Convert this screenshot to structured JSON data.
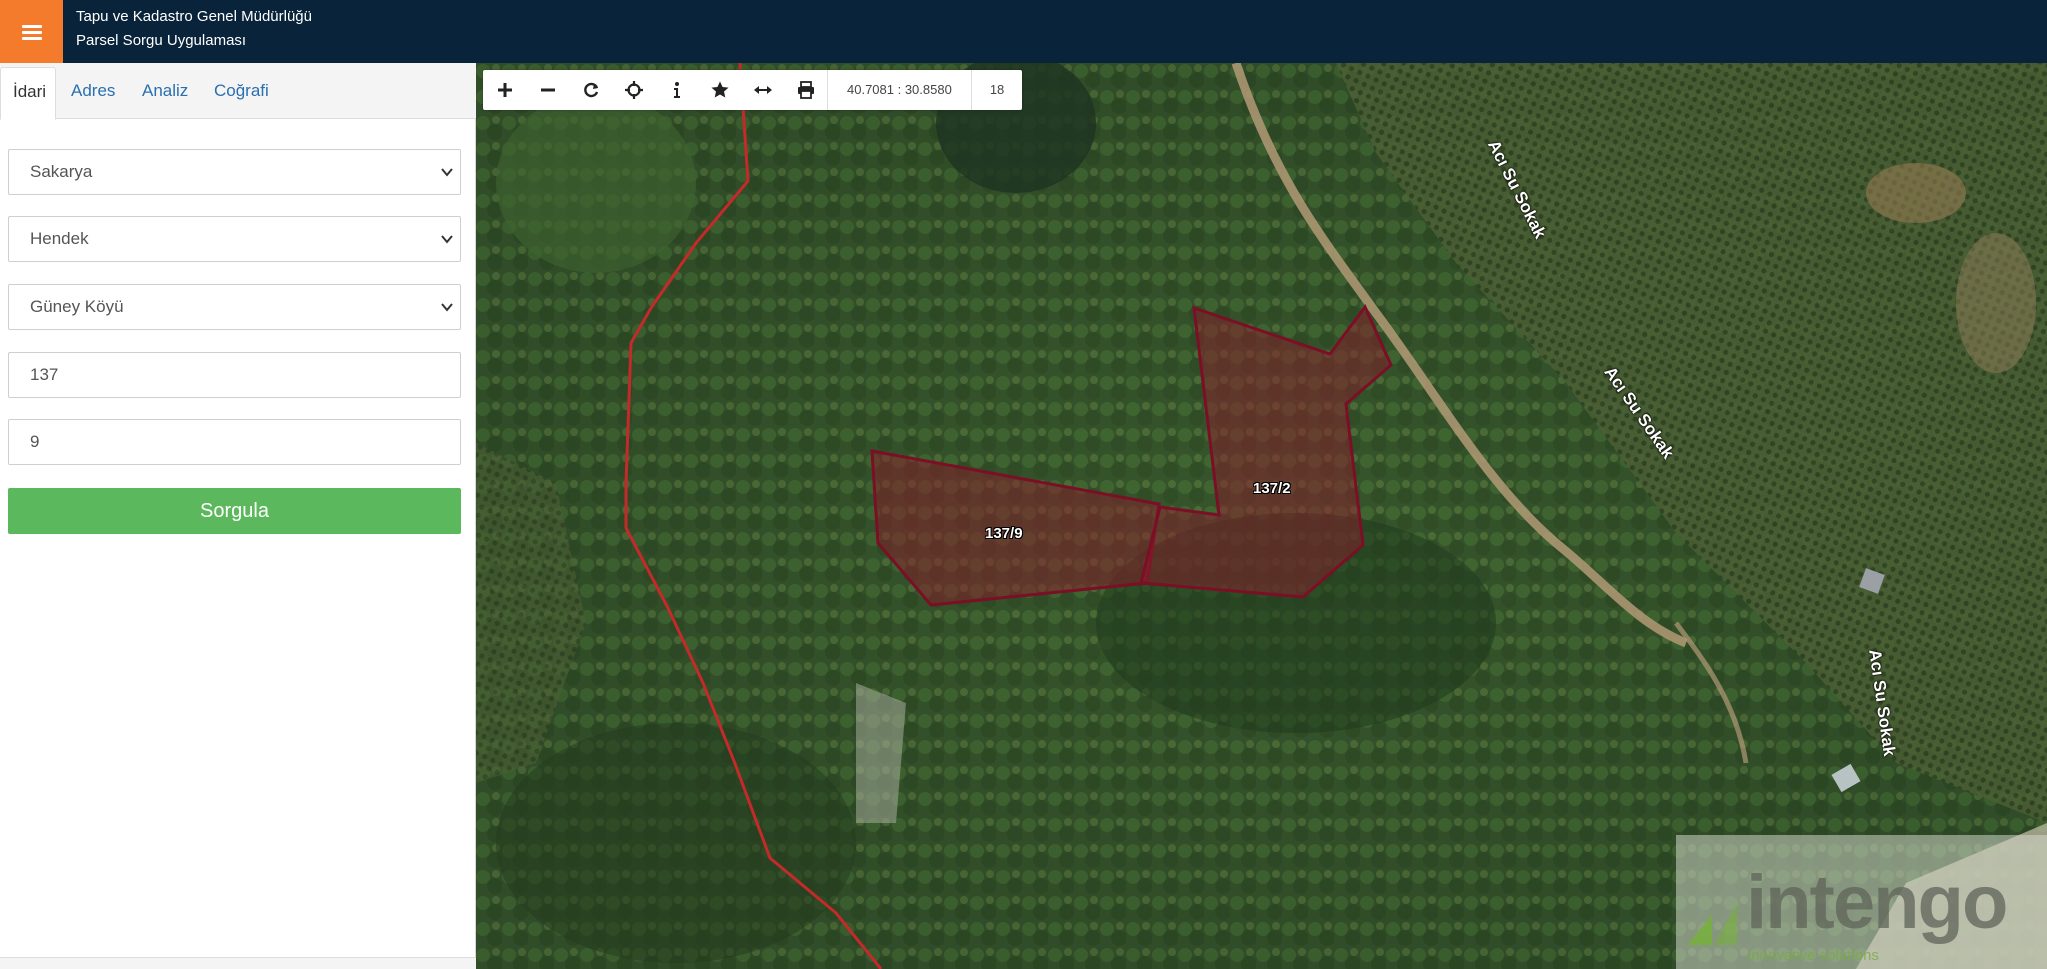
{
  "header": {
    "title_line1": "Tapu ve Kadastro Genel Müdürlüğü",
    "title_line2": "Parsel Sorgu Uygulaması",
    "accent_color": "#f47b2b",
    "background_color": "#08233a"
  },
  "sidebar": {
    "tabs": [
      {
        "label": "İdari",
        "active": true
      },
      {
        "label": "Adres",
        "active": false
      },
      {
        "label": "Analiz",
        "active": false
      },
      {
        "label": "Coğrafi",
        "active": false
      }
    ],
    "form": {
      "province": "Sakarya",
      "district": "Hendek",
      "neighborhood": "Güney Köyü",
      "block": "137",
      "parcel": "9",
      "submit_label": "Sorgula",
      "submit_color": "#5cb85c"
    }
  },
  "map": {
    "toolbar": {
      "icons": [
        "zoom-in-icon",
        "zoom-out-icon",
        "refresh-icon",
        "locate-icon",
        "info-icon",
        "favorite-icon",
        "measure-icon",
        "print-icon"
      ],
      "coordinates": "40.7081 : 30.8580",
      "zoom_level": "18"
    },
    "parcels": [
      {
        "label": "137/9",
        "highlighted": true
      },
      {
        "label": "137/2",
        "highlighted": true
      }
    ],
    "streets": [
      "Acı Su Sokak",
      "Acı Su Sokak",
      "Acı Su Sokak"
    ],
    "parcel_color": "#8b1c2c",
    "boundary_color": "#c42a2a",
    "watermark": {
      "name": "intengo",
      "tagline": "innovative solutions"
    }
  }
}
